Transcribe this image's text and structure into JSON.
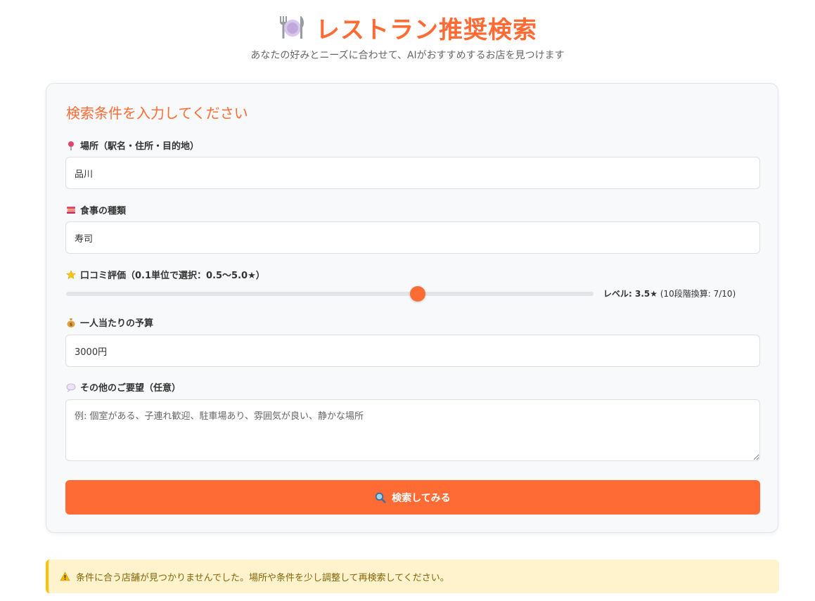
{
  "header": {
    "title": "レストラン推奨検索",
    "subtitle": "あなたの好みとニーズに合わせて、AIがおすすめするお店を見つけます"
  },
  "form": {
    "heading": "検索条件を入力してください",
    "location": {
      "label": "場所（駅名・住所・目的地）",
      "value": "品川"
    },
    "cuisine": {
      "label": "食事の種類",
      "value": "寿司"
    },
    "rating": {
      "label": "口コミ評価（0.1単位で選択：0.5〜5.0★）",
      "min": 0.5,
      "max": 5.0,
      "value": 3.5,
      "readout_prefix": "レベル: ",
      "readout_value": "3.5★",
      "readout_suffix": " (10段階換算: 7/10)"
    },
    "budget": {
      "label": "一人当たりの予算",
      "value": "3000円"
    },
    "requests": {
      "label": "その他のご要望（任意）",
      "placeholder": "例: 個室がある、子連れ歓迎、駐車場あり、雰囲気が良い、静かな場所"
    },
    "submit_label": "検索してみる"
  },
  "alert": {
    "message": "条件に合う店舗が見つかりませんでした。場所や条件を少し調整して再検索してください。"
  },
  "colors": {
    "accent": "#ff6b35",
    "alert_bg": "#fff3cd",
    "alert_border": "#ffc107",
    "alert_text": "#856404"
  },
  "icons": {
    "title": "plate-with-cutlery-icon",
    "location": "pin-icon",
    "cuisine": "books-icon",
    "rating": "star-icon",
    "budget": "money-bag-icon",
    "requests": "speech-bubble-icon",
    "submit": "magnifier-icon",
    "alert": "warning-icon"
  }
}
